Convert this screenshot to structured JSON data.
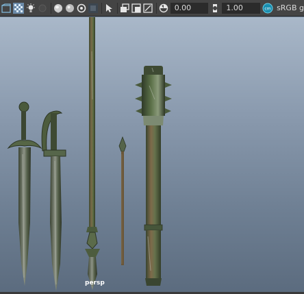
{
  "toolbar": {
    "icons": [
      "camera-attribute-icon",
      "grid-toggle-icon",
      "lighting-icon",
      "shadow-icon",
      "separator-icon",
      "sphere-shaded-icon",
      "sphere-wire-icon",
      "isolate-icon",
      "xray-icon",
      "select-cursor-icon",
      "separator-icon",
      "stack-icon",
      "layers-icon",
      "frame-icon",
      "exposure-icon"
    ],
    "exposure_value": "0.00",
    "gamma_value": "1.00",
    "color_management_label": "sRGB g"
  },
  "viewport": {
    "camera_label": "persp",
    "objects": [
      "sword-straight",
      "sword-curved-hilt",
      "spear-long",
      "arrow-short",
      "spiked-club"
    ]
  },
  "colors": {
    "toolbar_bg": "#444444",
    "viewport_top": "#a9b8c9",
    "viewport_bottom": "#5b6b7e",
    "accent": "#3ab0c8",
    "moss": "#5a6b45",
    "rust": "#7a5a3a"
  }
}
